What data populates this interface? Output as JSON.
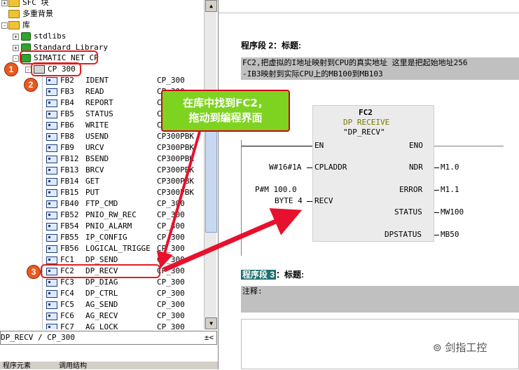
{
  "tree": {
    "top_items": [
      {
        "label": "SFC 块",
        "expander": "+"
      },
      {
        "label": "多重背景",
        "expander": ""
      },
      {
        "label": "库",
        "expander": "-"
      },
      {
        "label": "stdlibs",
        "expander": "+"
      },
      {
        "label": "Standard Library",
        "expander": "+"
      },
      {
        "label": "SIMATIC NET CP",
        "expander": "-"
      },
      {
        "label": "CP 300",
        "expander": "-"
      }
    ],
    "blocks": [
      {
        "name": "FB2",
        "sym": "IDENT",
        "fam": "CP_300"
      },
      {
        "name": "FB3",
        "sym": "READ",
        "fam": "CP_300"
      },
      {
        "name": "FB4",
        "sym": "REPORT",
        "fam": "CP_300"
      },
      {
        "name": "FB5",
        "sym": "STATUS",
        "fam": "CP_300"
      },
      {
        "name": "FB6",
        "sym": "WRITE",
        "fam": "CP_300"
      },
      {
        "name": "FB8",
        "sym": "USEND",
        "fam": "CP300PBK"
      },
      {
        "name": "FB9",
        "sym": "URCV",
        "fam": "CP300PBK"
      },
      {
        "name": "FB12",
        "sym": "BSEND",
        "fam": "CP300PBK"
      },
      {
        "name": "FB13",
        "sym": "BRCV",
        "fam": "CP300PBK"
      },
      {
        "name": "FB14",
        "sym": "GET",
        "fam": "CP300PBK"
      },
      {
        "name": "FB15",
        "sym": "PUT",
        "fam": "CP300PBK"
      },
      {
        "name": "FB40",
        "sym": "FTP_CMD",
        "fam": "CP_300"
      },
      {
        "name": "FB52",
        "sym": "PNIO_RW_REC",
        "fam": "CP_300"
      },
      {
        "name": "FB54",
        "sym": "PNIO_ALARM",
        "fam": "CP_300"
      },
      {
        "name": "FB55",
        "sym": "IP_CONFIG",
        "fam": "CP_300"
      },
      {
        "name": "FB56",
        "sym": "LOGICAL_TRIGGE",
        "fam": "CP_300"
      },
      {
        "name": "FC1",
        "sym": "DP_SEND",
        "fam": "CP_300"
      },
      {
        "name": "FC2",
        "sym": "DP_RECV",
        "fam": "CP_300"
      },
      {
        "name": "FC3",
        "sym": "DP_DIAG",
        "fam": "CP_300"
      },
      {
        "name": "FC4",
        "sym": "DP_CTRL",
        "fam": "CP_300"
      },
      {
        "name": "FC5",
        "sym": "AG_SEND",
        "fam": "CP_300"
      },
      {
        "name": "FC6",
        "sym": "AG_RECV",
        "fam": "CP_300"
      },
      {
        "name": "FC7",
        "sym": "AG_LOCK",
        "fam": "CP_300"
      }
    ],
    "status_text": "DP_RECV / CP_300",
    "status_icon_text": "±<",
    "tab_left": "程序元素",
    "tab_right": "调用结构"
  },
  "editor": {
    "seg2_title": "程序段 2：标题:",
    "seg2_comment_line1": "FC2,把虚拟的I地址映射到CPU的真实地址  这里是把起始地址256",
    "seg2_comment_line2": "-IB3映射到实际CPU上的MB100到MB103",
    "seg3_title_hl": "程序段 3",
    "seg3_title_rest": "：标题:",
    "seg3_comment": "注释:",
    "block": {
      "number": "FC2",
      "family": "DP RECEIVE",
      "symbol": "\"DP_RECV\"",
      "in_en": "EN",
      "in_cpladdr": "CPLADDR",
      "in_recv": "RECV",
      "out_eno": "ENO",
      "out_ndr": "NDR",
      "out_error": "ERROR",
      "out_status": "STATUS",
      "out_dpstatus": "DPSTATUS",
      "arg_cpladdr": "W#16#1A",
      "arg_recv_1": "P#M 100.0",
      "arg_recv_2": "BYTE 4",
      "arg_ndr": "M1.0",
      "arg_error": "M1.1",
      "arg_status": "MW100",
      "arg_dpstatus": "MB50"
    }
  },
  "annotations": {
    "callout_line1": "在库中找到FC2，",
    "callout_line2": "拖动到编程界面",
    "badge1": "1",
    "badge2": "2",
    "badge3": "3",
    "arrow_color": "#e8112d",
    "watermark": "剑指工控"
  }
}
